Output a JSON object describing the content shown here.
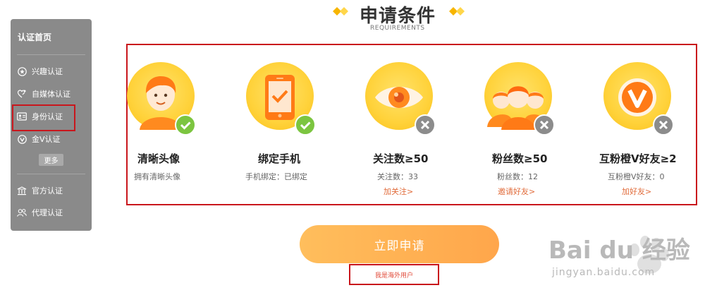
{
  "sidebar": {
    "title": "认证首页",
    "items": [
      {
        "label": "兴趣认证",
        "icon": "star-circle-icon"
      },
      {
        "label": "自媒体认证",
        "icon": "media-icon"
      },
      {
        "label": "身份认证",
        "icon": "id-card-icon"
      },
      {
        "label": "金V认证",
        "icon": "v-check-icon"
      }
    ],
    "more_label": "更多",
    "bottom_items": [
      {
        "label": "官方认证",
        "icon": "building-icon"
      },
      {
        "label": "代理认证",
        "icon": "agent-icon"
      }
    ]
  },
  "header": {
    "title": "申请条件",
    "subtitle": "REQUIREMENTS"
  },
  "requirements": [
    {
      "title": "清晰头像",
      "desc": "拥有清晰头像",
      "link": "",
      "status": "met",
      "icon": "avatar-person-icon"
    },
    {
      "title": "绑定手机",
      "desc": "手机绑定：已绑定",
      "link": "",
      "status": "met",
      "icon": "phone-check-icon"
    },
    {
      "title": "关注数≥50",
      "desc": "关注数：33",
      "link": "加关注>",
      "status": "unmet",
      "icon": "eye-icon"
    },
    {
      "title": "粉丝数≥50",
      "desc": "粉丝数：12",
      "link": "邀请好友>",
      "status": "unmet",
      "icon": "fans-group-icon"
    },
    {
      "title": "互粉橙V好友≥2",
      "desc": "互粉橙V好友：0",
      "link": "加好友>",
      "status": "unmet",
      "icon": "orange-v-icon"
    }
  ],
  "apply_button": "立即申请",
  "overseas_link": "我是海外用户",
  "watermark": {
    "brand": "Bai du 经验",
    "url": "jingyan.baidu.com"
  },
  "colors": {
    "accent_orange": "#ffa64b",
    "met_green": "#7cc540",
    "unmet_gray": "#8c8c8c",
    "highlight_red": "#c9161c"
  }
}
